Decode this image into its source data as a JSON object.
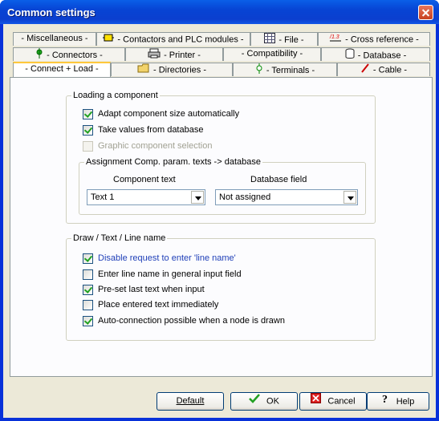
{
  "window": {
    "title": "Common settings"
  },
  "tabs": {
    "row1": [
      {
        "label": "- Miscellaneous -"
      },
      {
        "label": "- Contactors and PLC modules -"
      },
      {
        "label": "- File -"
      },
      {
        "label": "- Cross reference -"
      }
    ],
    "row2": [
      {
        "label": "- Connectors -"
      },
      {
        "label": "- Printer -"
      },
      {
        "label": "- Compatibility -"
      },
      {
        "label": "- Database -"
      }
    ],
    "row3": [
      {
        "label": "- Connect + Load -"
      },
      {
        "label": "- Directories -"
      },
      {
        "label": "- Terminals -"
      },
      {
        "label": "- Cable -"
      }
    ],
    "active": "- Connect + Load -"
  },
  "loading": {
    "title": "Loading a component",
    "options": [
      {
        "label": "Adapt component size automatically",
        "checked": true,
        "enabled": true
      },
      {
        "label": "Take values from database",
        "checked": true,
        "enabled": true
      },
      {
        "label": "Graphic component selection",
        "checked": false,
        "enabled": false
      }
    ],
    "assignment": {
      "title": "Assignment Comp. param. texts  -> database",
      "component_text_label": "Component text",
      "database_field_label": "Database field",
      "component_text_value": "Text 1",
      "database_field_value": "Not assigned"
    }
  },
  "draw": {
    "title": "Draw / Text  / Line name",
    "options": [
      {
        "label": "Disable request to enter 'line name'",
        "checked": true
      },
      {
        "label": "Enter line name in general input field",
        "checked": false
      },
      {
        "label": "Pre-set last text when input",
        "checked": true
      },
      {
        "label": "Place entered text immediately",
        "checked": false
      },
      {
        "label": "Auto-connection possible when a node is drawn",
        "checked": true
      }
    ]
  },
  "buttons": {
    "default": "Default",
    "ok": "OK",
    "cancel": "Cancel",
    "help": "Help"
  },
  "colors": {
    "titlebar": "#0a5fe8",
    "dialog_bg": "#ece9d8",
    "accent_tab": "#ffc83c"
  }
}
